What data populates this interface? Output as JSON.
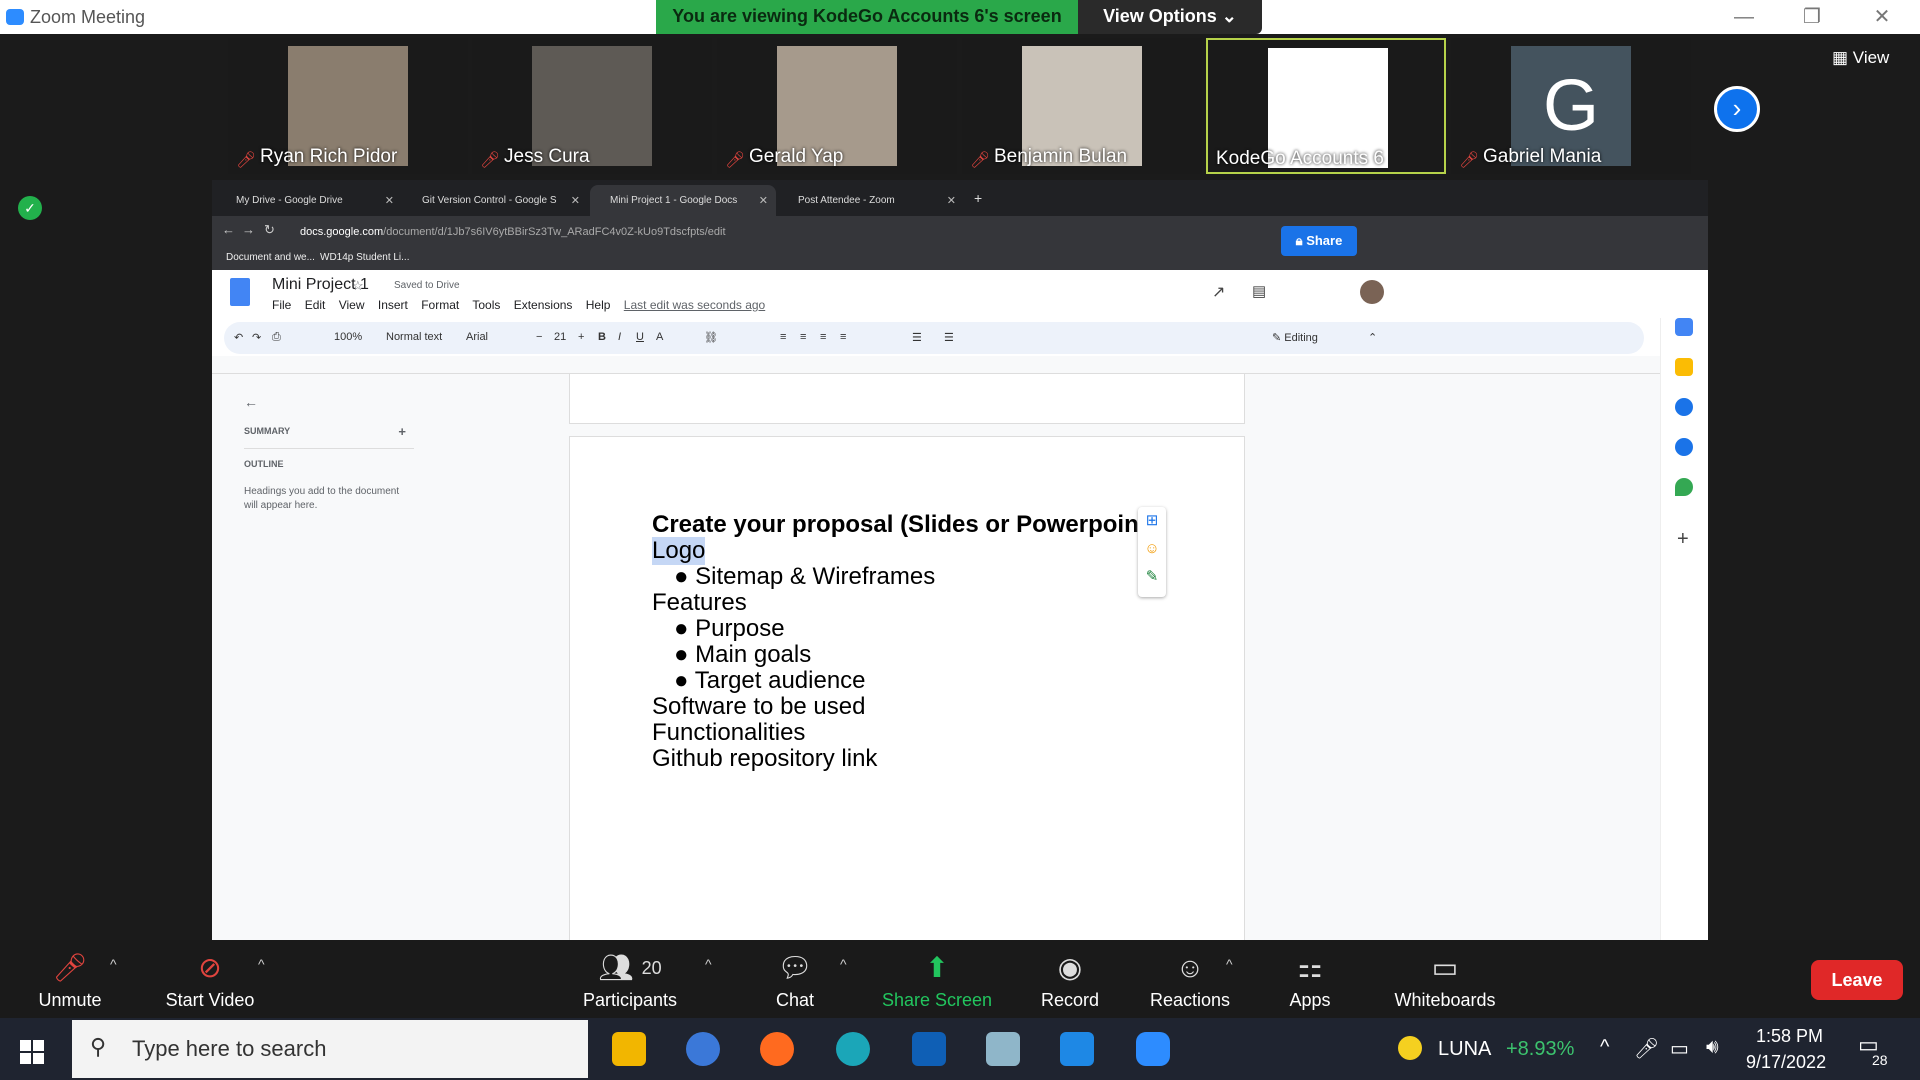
{
  "window": {
    "title": "Zoom Meeting",
    "minimize": "—",
    "restore": "❐",
    "close": "✕"
  },
  "banner": {
    "viewing_text": "You are viewing KodeGo Accounts 6's screen",
    "view_options": "View Options ⌄"
  },
  "gallery": {
    "view_label": "View",
    "participants": [
      {
        "name": "Ryan Rich Pidor",
        "avatar_color": "#8a7d6e",
        "muted": true
      },
      {
        "name": "Jess Cura",
        "avatar_color": "#5e5a55",
        "muted": true
      },
      {
        "name": "Gerald Yap",
        "avatar_color": "#a69a8c",
        "muted": true
      },
      {
        "name": "Benjamin Bulan",
        "avatar_color": "#c9c2b8",
        "muted": true
      },
      {
        "name": "KodeGo Accounts 6",
        "avatar_color": "#ffffff",
        "muted": false,
        "active_speaker": true
      },
      {
        "name": "Gabriel Mania",
        "avatar_color": "#44535e",
        "muted": true,
        "initial": "G"
      }
    ],
    "next_icon": "›"
  },
  "browser": {
    "tabs": [
      {
        "label": "My Drive - Google Drive"
      },
      {
        "label": "Git Version Control - Google S"
      },
      {
        "label": "Mini Project 1 - Google Docs",
        "active": true
      },
      {
        "label": "Post Attendee - Zoom"
      }
    ],
    "url_domain": "docs.google.com",
    "url_path": "/document/d/1Jb7s6IV6ytBBirSz3Tw_ARadFC4v0Z-kUo9Tdscfpts/edit",
    "bookmarks": [
      "Document and we...",
      "WD14p Student Li..."
    ]
  },
  "docs": {
    "title": "Mini Project 1",
    "saved": "Saved to Drive",
    "menus": [
      "File",
      "Edit",
      "View",
      "Insert",
      "Format",
      "Tools",
      "Extensions",
      "Help"
    ],
    "last_edit": "Last edit was seconds ago",
    "share": "Share",
    "toolbar": {
      "zoom": "100%",
      "style": "Normal text",
      "font": "Arial",
      "size": "21",
      "mode": "Editing"
    },
    "outline": {
      "summary": "SUMMARY",
      "outline": "OUTLINE",
      "hint": "Headings you add to the document will appear here."
    },
    "content": {
      "heading": "Create your proposal (Slides or Powerpoint)",
      "logo": "Logo",
      "b1": "Sitemap & Wireframes",
      "features": "Features",
      "b2": "Purpose",
      "b3": "Main goals",
      "b4": "Target audience",
      "software": "Software to be used",
      "functionalities": "Functionalities",
      "github": "Github repository link"
    }
  },
  "zoom_toolbar": {
    "unmute": "Unmute",
    "start_video": "Start Video",
    "participants": "Participants",
    "participants_count": "20",
    "chat": "Chat",
    "share_screen": "Share Screen",
    "record": "Record",
    "reactions": "Reactions",
    "apps": "Apps",
    "whiteboards": "Whiteboards",
    "leave": "Leave"
  },
  "taskbar": {
    "search_placeholder": "Type here to search",
    "ticker": "LUNA",
    "ticker_change": "+8.93%",
    "time": "1:58 PM",
    "date": "9/17/2022",
    "notifications": "28"
  }
}
